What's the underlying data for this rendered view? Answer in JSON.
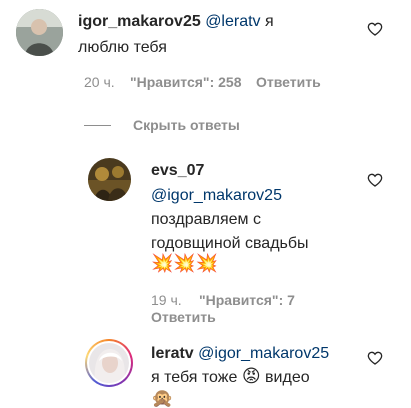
{
  "comments": [
    {
      "username": "igor_makarov25",
      "mention": "@leratv",
      "text_line1": "я",
      "text_line2": "люблю тебя",
      "time": "20 ч.",
      "likes": "\"Нравится\": 258",
      "reply": "Ответить"
    }
  ],
  "toggle_replies": "Скрыть ответы",
  "replies": [
    {
      "username": "evs_07",
      "mention": "@igor_makarov25",
      "text_line1": "поздравляем с",
      "text_line2": "годовщиной свадьбы",
      "emoji_line": "💥💥💥",
      "time": "19 ч.",
      "likes": "\"Нравится\": 7",
      "reply": "Ответить"
    },
    {
      "username": "leratv",
      "mention": "@igor_makarov25",
      "text_line2_a": "я тебя тоже",
      "text_line2_emoji": "😡",
      "text_line2_b": "видео",
      "text_line3_emoji": "🙊"
    }
  ],
  "colors": {
    "text": "#262626",
    "secondary": "#8e8e8e",
    "mention": "#00376b"
  },
  "icons": {
    "like": "heart-outline-icon"
  }
}
